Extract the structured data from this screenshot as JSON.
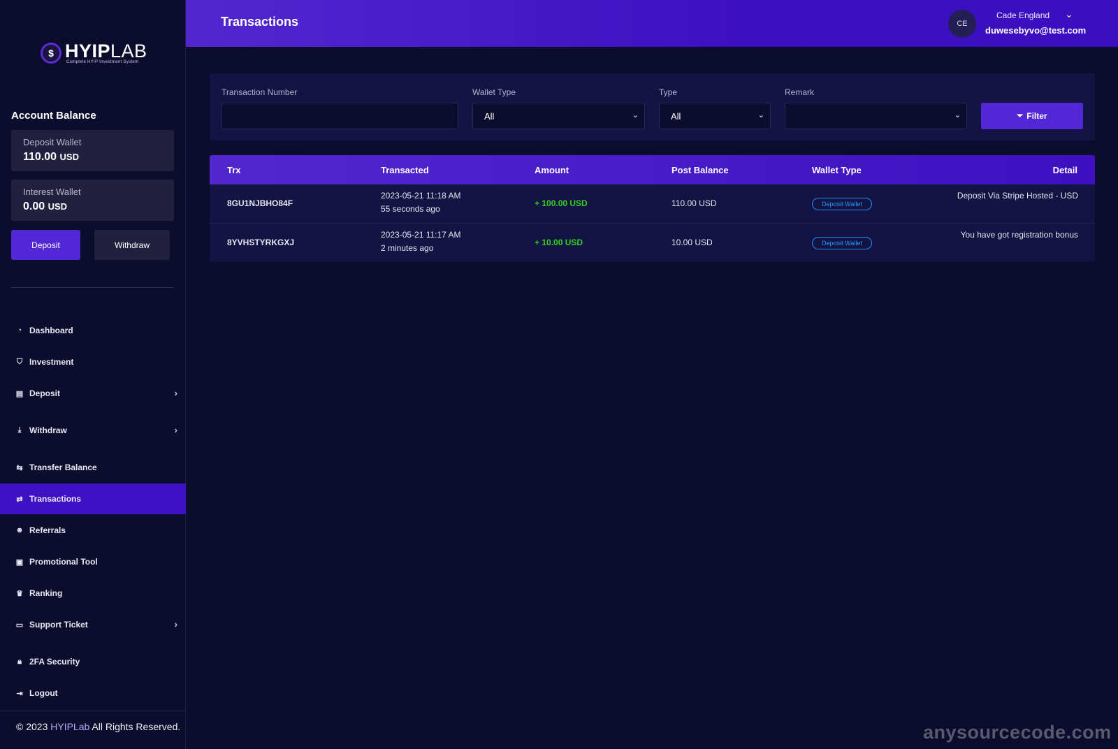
{
  "brand": {
    "logo_text_bold": "HYIP",
    "logo_text_light": "LAB",
    "tagline": "Complete HYIP Investment System",
    "accent_color": "#5227d6"
  },
  "sidebar": {
    "account_balance_title": "Account Balance",
    "deposit_wallet": {
      "label": "Deposit Wallet",
      "amount": "110.00",
      "currency": "USD"
    },
    "interest_wallet": {
      "label": "Interest Wallet",
      "amount": "0.00",
      "currency": "USD"
    },
    "deposit_button": "Deposit",
    "withdraw_button": "Withdraw",
    "nav": [
      {
        "label": "Dashboard",
        "icon": "dashboard-icon"
      },
      {
        "label": "Investment",
        "icon": "investment-icon"
      },
      {
        "label": "Deposit",
        "icon": "deposit-icon",
        "has_submenu": true
      },
      {
        "label": "Withdraw",
        "icon": "withdraw-icon",
        "has_submenu": true
      },
      {
        "label": "Transfer Balance",
        "icon": "transfer-icon"
      },
      {
        "label": "Transactions",
        "icon": "exchange-icon",
        "active": true
      },
      {
        "label": "Referrals",
        "icon": "users-icon"
      },
      {
        "label": "Promotional Tool",
        "icon": "ad-icon"
      },
      {
        "label": "Ranking",
        "icon": "crown-icon"
      },
      {
        "label": "Support Ticket",
        "icon": "ticket-icon",
        "has_submenu": true
      },
      {
        "label": "2FA Security",
        "icon": "lock-icon"
      },
      {
        "label": "Logout",
        "icon": "logout-icon"
      }
    ],
    "footer": {
      "prefix": "© 2023 ",
      "brand": "HYIPLab",
      "suffix": " All Rights Reserved."
    }
  },
  "header": {
    "title": "Transactions",
    "avatar_initials": "CE",
    "user_name": "Cade England",
    "user_email": "duwesebyvo@test.com"
  },
  "filter": {
    "trx_label": "Transaction Number",
    "trx_value": "",
    "wallet_type_label": "Wallet Type",
    "wallet_type_value": "All",
    "type_label": "Type",
    "type_value": "All",
    "remark_label": "Remark",
    "remark_value": "",
    "filter_button": "Filter"
  },
  "table": {
    "columns": [
      "Trx",
      "Transacted",
      "Amount",
      "Post Balance",
      "Wallet Type",
      "Detail"
    ],
    "rows": [
      {
        "trx": "8GU1NJBHO84F",
        "date": "2023-05-21 11:18 AM",
        "ago": "55 seconds ago",
        "amount": "+ 100.00 USD",
        "post_balance": "110.00 USD",
        "wallet_type": "Deposit Wallet",
        "detail": "Deposit Via Stripe Hosted - USD"
      },
      {
        "trx": "8YVHSTYRKGXJ",
        "date": "2023-05-21 11:17 AM",
        "ago": "2 minutes ago",
        "amount": "+ 10.00 USD",
        "post_balance": "10.00 USD",
        "wallet_type": "Deposit Wallet",
        "detail": "You have got registration bonus"
      }
    ]
  },
  "watermark": "anysourcecode.com"
}
